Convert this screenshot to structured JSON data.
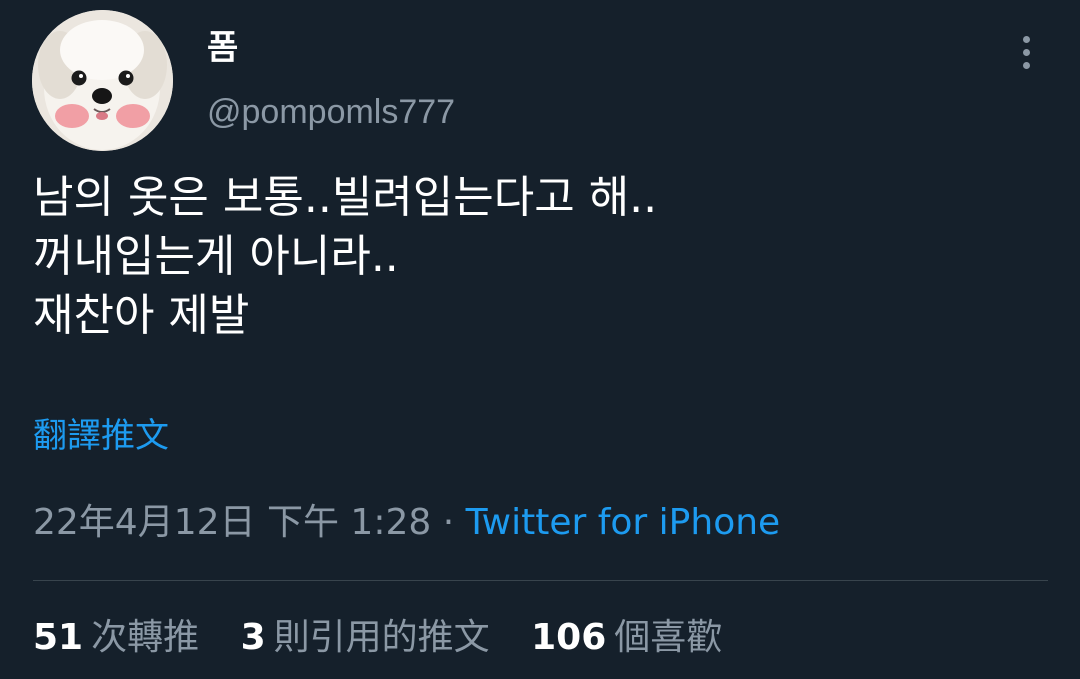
{
  "user": {
    "display_name": "폼",
    "handle": "@pompomls777",
    "avatar_icon": "puppy-avatar"
  },
  "tweet": {
    "lines": [
      "남의 옷은 보통..빌려입는다고 해..",
      "꺼내입는게 아니라..",
      "재찬아 제발"
    ],
    "translate_label": "翻譯推文"
  },
  "meta": {
    "timestamp": "22年4月12日 下午 1:28",
    "separator": "·",
    "source": "Twitter for iPhone"
  },
  "stats": {
    "retweets_count": "51",
    "retweets_label": "次轉推",
    "quotes_count": "3",
    "quotes_label": "則引用的推文",
    "likes_count": "106",
    "likes_label": "個喜歡"
  },
  "colors": {
    "background": "#15202b",
    "text": "#ffffff",
    "secondary_text": "#8b98a5",
    "accent": "#1d9bf0",
    "divider": "#38444d"
  },
  "icons": {
    "more": "more-vertical-icon"
  }
}
